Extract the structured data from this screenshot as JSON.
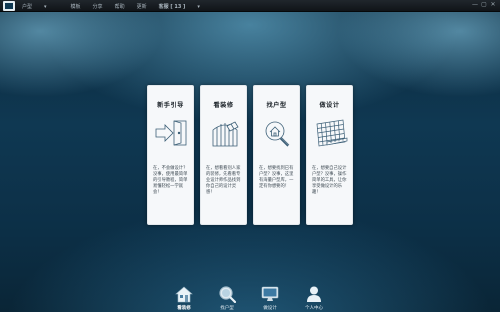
{
  "topbar": {
    "items": [
      {
        "label": "户型",
        "caret": true
      },
      {
        "label": "模板"
      },
      {
        "label": "分享"
      },
      {
        "label": "帮助"
      },
      {
        "label": "更新"
      },
      {
        "label": "客服 [ 13 ]",
        "caret": true
      }
    ],
    "window_controls": [
      "—",
      "▢",
      "✕"
    ]
  },
  "cards": [
    {
      "title": "新手引导",
      "icon": "door-enter-icon",
      "description": "在，不会做设计？没事，使用最简单的引导教程，简单易懂轻松一学就会！"
    },
    {
      "title": "看装修",
      "icon": "paint-roller-icon",
      "description": "在，想看看别人家的装修，先看看专业设计师作品找到你自己的设计灵感！"
    },
    {
      "title": "找户型",
      "icon": "search-house-icon",
      "description": "在，想要找到已有户型？没事，这里有海量户型库，一定有你想要的！"
    },
    {
      "title": "做设计",
      "icon": "floorplan-ruler-icon",
      "description": "在，想要自己设计户型？没事，操作简单的工具，让你享受做设计的乐趣！"
    }
  ],
  "dock": [
    {
      "label": "看装修",
      "icon": "house-icon",
      "active": true
    },
    {
      "label": "找户型",
      "icon": "magnifier-icon",
      "active": false
    },
    {
      "label": "做设计",
      "icon": "monitor-icon",
      "active": false
    },
    {
      "label": "个人中心",
      "icon": "user-icon",
      "active": false
    }
  ],
  "colors": {
    "background": "#0f3852",
    "card": "#f6f8fa",
    "topbar": "#15191d",
    "card_line": "#3c5f77"
  }
}
